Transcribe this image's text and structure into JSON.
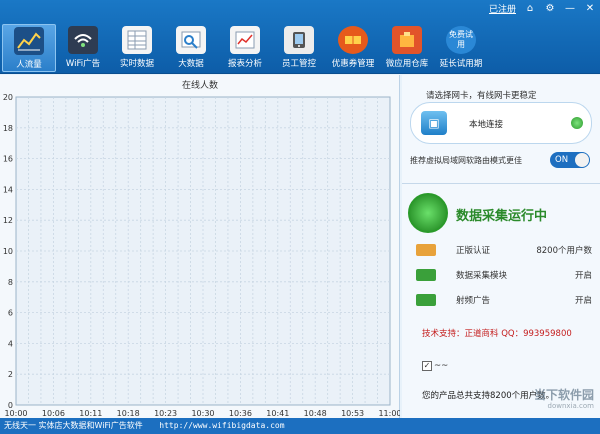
{
  "window": {
    "register_label": "已注册",
    "icons": {
      "home": "home-icon",
      "settings": "gear-icon",
      "minimize": "minimize-icon",
      "close": "close-icon"
    }
  },
  "nav": [
    {
      "label": "人流量",
      "icon": "traffic-chart-icon",
      "active": true
    },
    {
      "label": "WiFi广告",
      "icon": "wifi-ad-icon",
      "active": false
    },
    {
      "label": "实时数据",
      "icon": "realtime-data-icon",
      "active": false
    },
    {
      "label": "大数据",
      "icon": "big-data-icon",
      "active": false
    },
    {
      "label": "报表分析",
      "icon": "report-icon",
      "active": false
    },
    {
      "label": "员工管控",
      "icon": "staff-control-icon",
      "active": false
    },
    {
      "label": "优惠券管理",
      "icon": "coupon-icon",
      "active": false
    },
    {
      "label": "微应用仓库",
      "icon": "app-store-icon",
      "active": false
    },
    {
      "label": "延长试用期",
      "icon": "free-trial-icon",
      "active": false
    }
  ],
  "free_trial_badge": "免费试用",
  "chart_data": {
    "type": "line",
    "title": "在线人数",
    "x": [
      "10:00",
      "10:06",
      "10:11",
      "10:18",
      "10:23",
      "10:30",
      "10:36",
      "10:41",
      "10:48",
      "10:53",
      "11:00"
    ],
    "ylim": [
      0,
      20
    ],
    "yticks": [
      0,
      2,
      4,
      6,
      8,
      10,
      12,
      14,
      16,
      18,
      20
    ],
    "grid": true,
    "series": []
  },
  "network": {
    "tip": "请选择网卡，有线网卡更稳定",
    "connection_name": "本地连接",
    "connection_icon": "network-adapter-icon",
    "vrouter_tip": "推荐虚拟局域网软路由模式更佳",
    "vrouter_toggle": "ON"
  },
  "status": {
    "title": "数据采集运行中",
    "icon": "radar-icon",
    "rows": [
      {
        "label": "正版认证",
        "value": "8200个用户数",
        "icon": "certificate-icon"
      },
      {
        "label": "数据采集模块",
        "value": "开启",
        "icon": "module-on-icon"
      },
      {
        "label": "射频广告",
        "value": "开启",
        "icon": "module-on-icon"
      }
    ],
    "support": "技术支持：正道商科 QQ：993959800",
    "checkbox_label": "~~",
    "product_note": "您的产品总共支持8200个用户数。"
  },
  "statusbar": {
    "text": "无线天一 实体店大数据和WiFi广告软件",
    "url": "http://www.wifibigdata.com"
  },
  "watermark": {
    "main": "当下软件园",
    "sub": "downxia.com"
  },
  "colors": {
    "accent": "#1a78c6",
    "running": "#2a8a2a",
    "support": "#c41e1e"
  }
}
